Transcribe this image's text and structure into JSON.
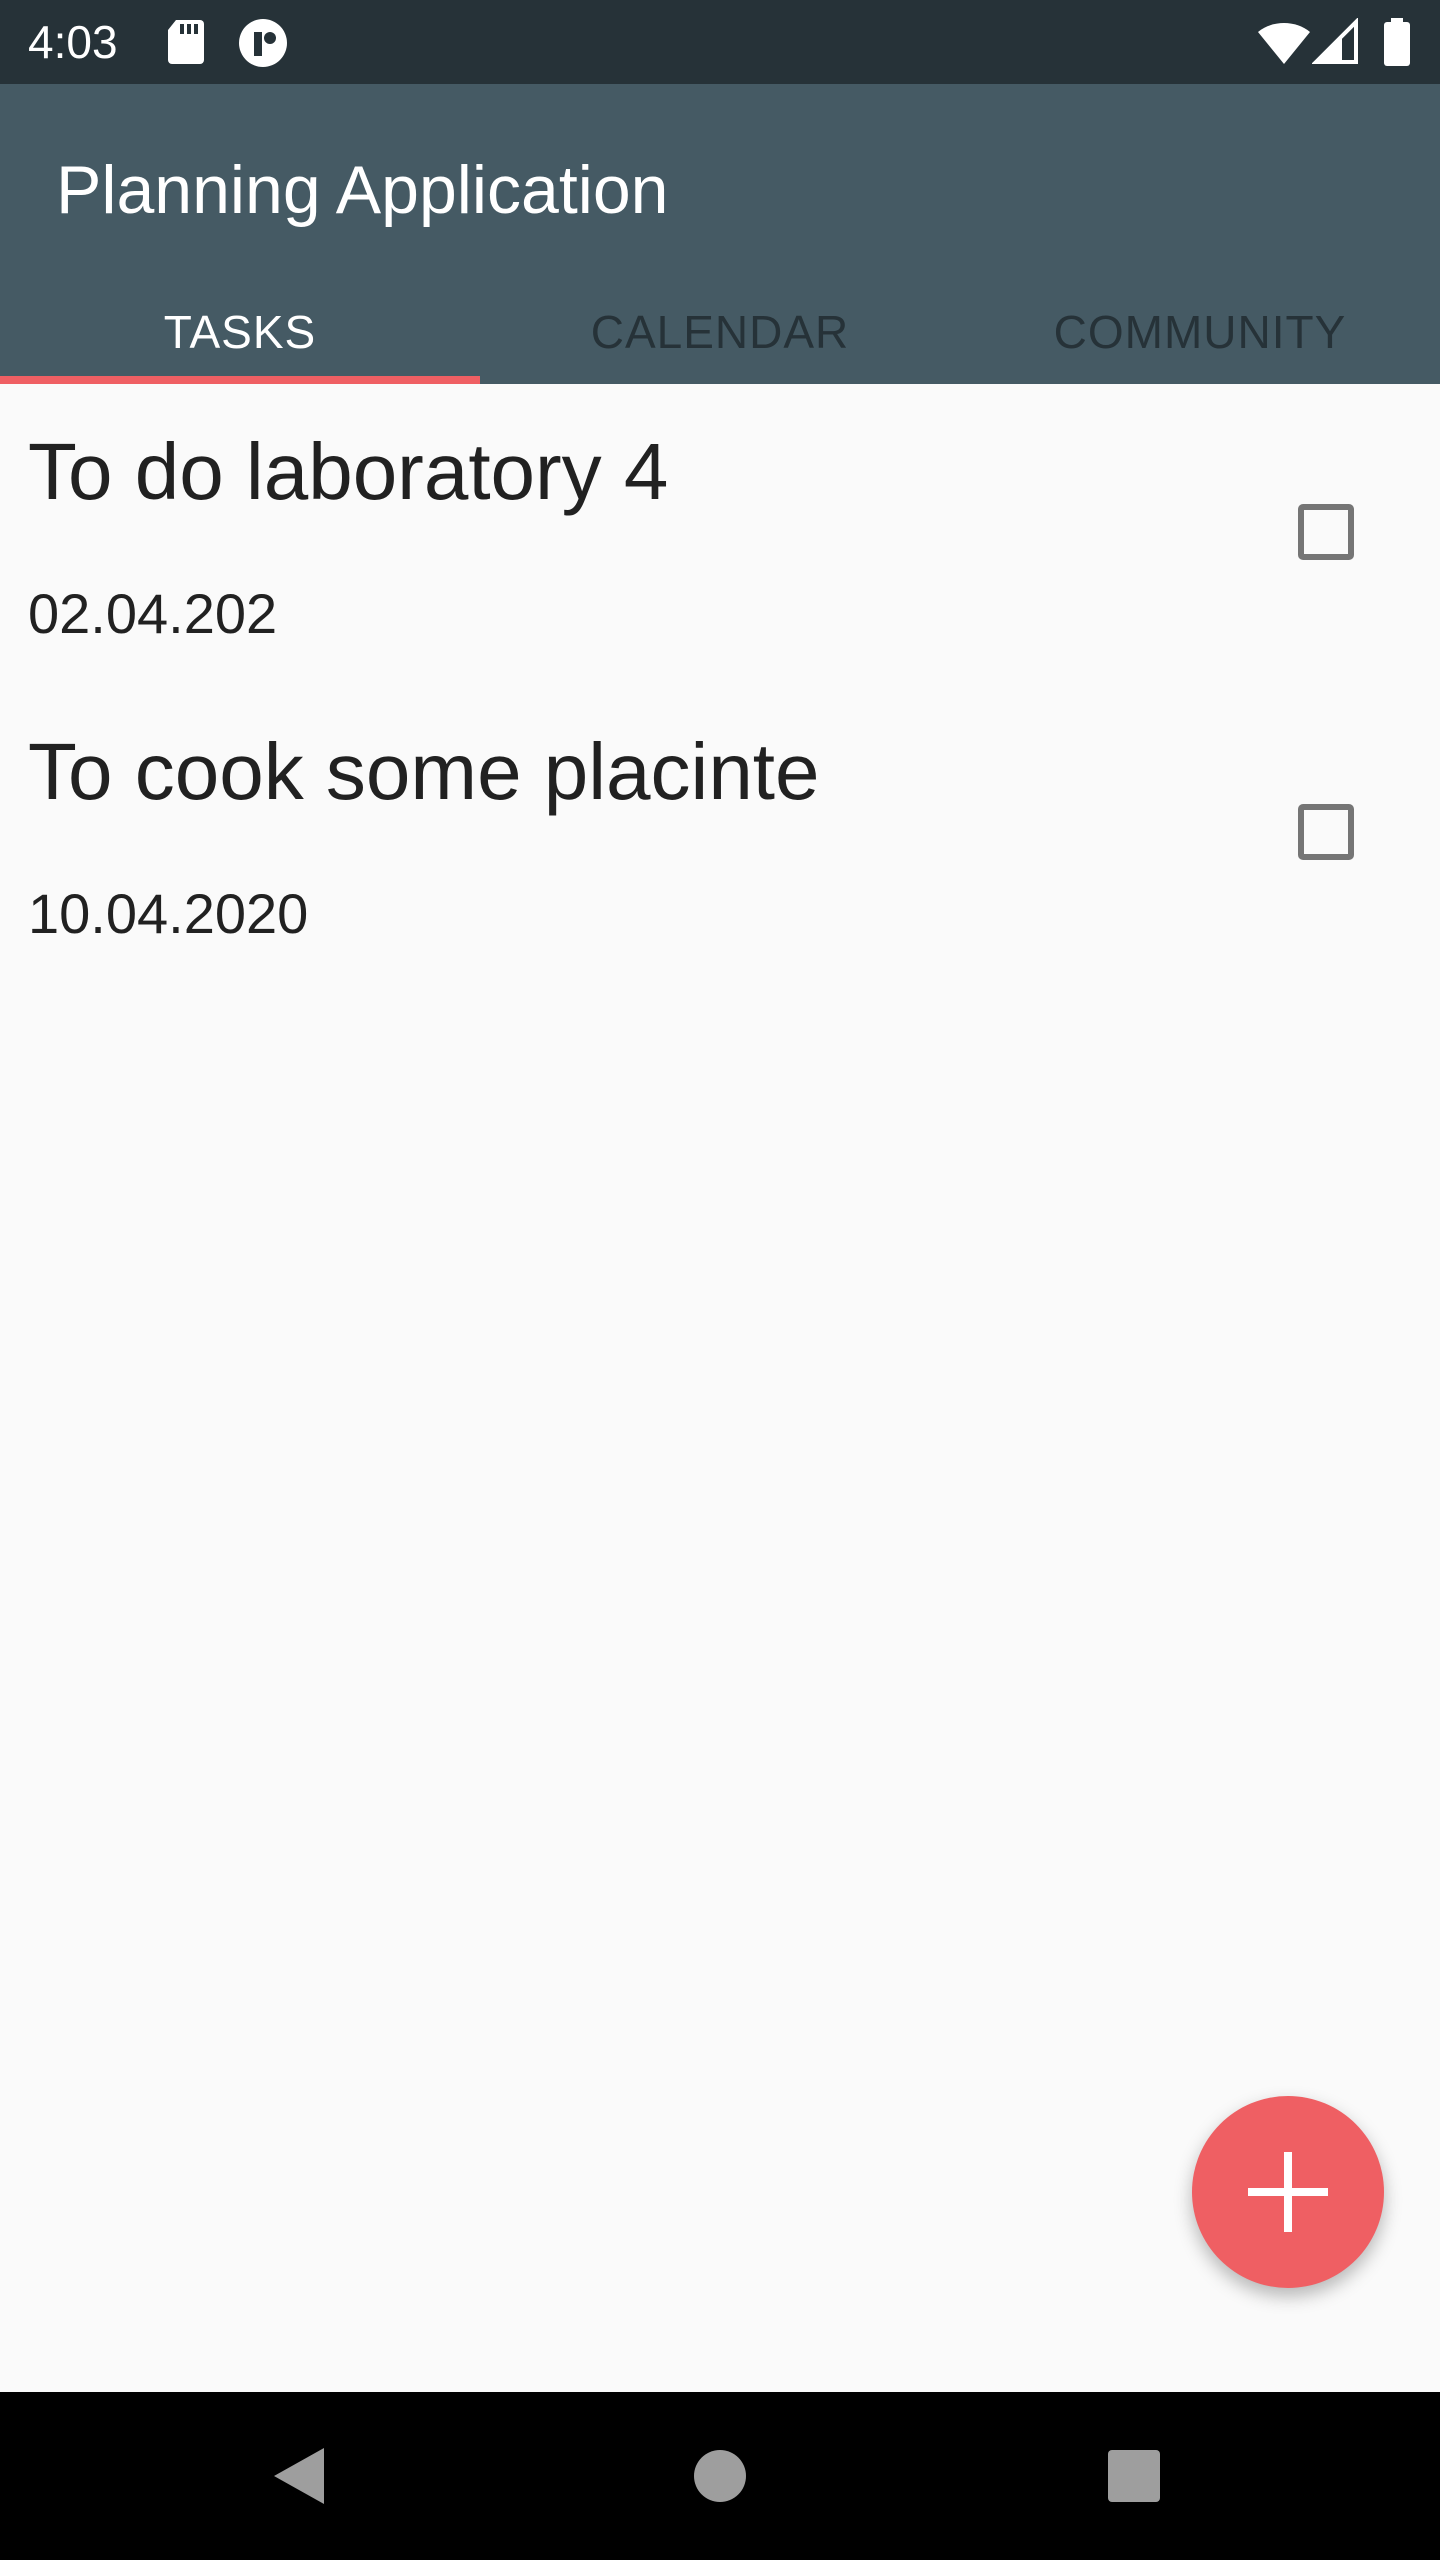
{
  "status_bar": {
    "time": "4:03",
    "left_icons": [
      "sd-card-icon",
      "app-notification-icon"
    ],
    "right_icons": [
      "wifi-icon",
      "cellular-signal-icon",
      "battery-icon"
    ]
  },
  "app_bar": {
    "title": "Planning Application",
    "background_color": "#455a64"
  },
  "tabs": [
    {
      "label": "TASKS",
      "active": true
    },
    {
      "label": "CALENDAR",
      "active": false
    },
    {
      "label": "COMMUNITY",
      "active": false
    }
  ],
  "tasks": [
    {
      "title": "To do laboratory 4",
      "date": "02.04.202",
      "checked": false
    },
    {
      "title": "To cook some placinte",
      "date": "10.04.2020",
      "checked": false
    }
  ],
  "fab": {
    "icon": "add-icon",
    "color": "#ef5f63"
  },
  "nav_bar": {
    "icons": [
      "back-icon",
      "home-icon",
      "recents-icon"
    ]
  },
  "colors": {
    "status_bar": "#263238",
    "accent": "#ef5f63",
    "background": "#fafafa"
  }
}
